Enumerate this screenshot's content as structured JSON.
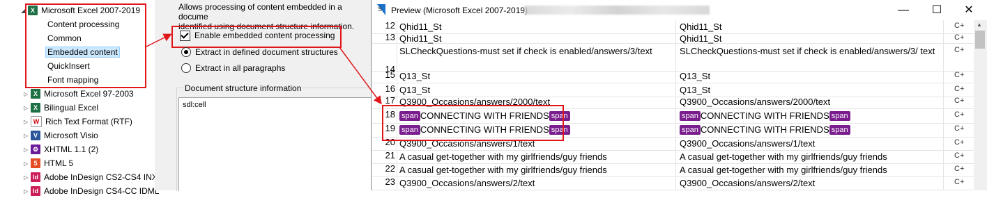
{
  "tree": {
    "items": [
      {
        "label": "Microsoft Excel 2007-2019",
        "icon": "excel-icon",
        "expander": "◢"
      },
      {
        "label": "Content processing"
      },
      {
        "label": "Common"
      },
      {
        "label": "Embedded content"
      },
      {
        "label": "QuickInsert"
      },
      {
        "label": "Font mapping"
      },
      {
        "label": "Microsoft Excel 97-2003",
        "icon": "excel-icon",
        "expander": "▷"
      },
      {
        "label": "Bilingual Excel",
        "icon": "excel-icon",
        "expander": "▷"
      },
      {
        "label": "Rich Text Format (RTF)",
        "icon": "rtf-icon",
        "expander": "▷"
      },
      {
        "label": "Microsoft Visio",
        "icon": "visio-icon",
        "expander": "▷"
      },
      {
        "label": "XHTML 1.1 (2)",
        "icon": "xhtml-icon",
        "expander": "▷"
      },
      {
        "label": "HTML 5",
        "icon": "html5-icon",
        "expander": "▷"
      },
      {
        "label": "Adobe InDesign CS2-CS4 INX",
        "icon": "indesign-icon",
        "expander": "▷"
      },
      {
        "label": "Adobe InDesign CS4-CC IDML",
        "icon": "indesign-icon",
        "expander": "▷"
      }
    ]
  },
  "settings": {
    "description": "Allows processing of content embedded in a docume... identified using document structure information.",
    "description_line1": "Allows processing of content embedded in a docume",
    "description_line2": "identified using document structure information.",
    "enable_label": "Enable embedded content processing",
    "radio1_label": "Extract in defined document structures",
    "radio2_label": "Extract in all paragraphs",
    "group_title": "Document structure information",
    "structure_value": "sdl:cell"
  },
  "preview": {
    "title": "Preview (Microsoft Excel 2007-2019)",
    "minimize": "—",
    "maximize": "☐",
    "close": "✕",
    "tag_label": "span",
    "rows": [
      {
        "n": "12",
        "src": "Qhid11_St",
        "tgt": "Qhid11_St",
        "st": "C+"
      },
      {
        "n": "13",
        "src": "Qhid11_St",
        "tgt": "Qhid11_St",
        "st": "C+"
      },
      {
        "n": "14",
        "src": "SLCheckQuestions-must set if check is enabled/answers/3/text",
        "tgt": "SLCheckQuestions-must set if check is enabled/answers/3/ text",
        "st": "C+"
      },
      {
        "n": "15",
        "src": "Q13_St",
        "tgt": "Q13_St",
        "st": "C+"
      },
      {
        "n": "16",
        "src": "Q13_St",
        "tgt": "Q13_St",
        "st": "C+"
      },
      {
        "n": "17",
        "src": "Q3900_Occasions/answers/2000/text",
        "tgt": "Q3900_Occasions/answers/2000/text",
        "st": "C+"
      },
      {
        "n": "18",
        "src": "CONNECTING WITH FRIENDS",
        "tgt": "CONNECTING WITH FRIENDS",
        "st": "C+"
      },
      {
        "n": "19",
        "src": "CONNECTING WITH FRIENDS",
        "tgt": "CONNECTING WITH FRIENDS",
        "st": "C+"
      },
      {
        "n": "20",
        "src": "Q3900_Occasions/answers/1/text",
        "tgt": "Q3900_Occasions/answers/1/text",
        "st": "C+"
      },
      {
        "n": "21",
        "src": "A casual get-together with my girlfriends/guy friends",
        "tgt": "A casual get-together with my girlfriends/guy friends",
        "st": "C+"
      },
      {
        "n": "22",
        "src": "A casual get-together with my girlfriends/guy friends",
        "tgt": "A casual get-together with my girlfriends/guy friends",
        "st": "C+"
      },
      {
        "n": "23",
        "src": "Q3900_Occasions/answers/2/text",
        "tgt": "Q3900_Occasions/answers/2/text",
        "st": "C+"
      }
    ]
  },
  "colors": {
    "highlight_red": "#e0161b",
    "tag_purple": "#7a1e8e",
    "selection": "#cce8ff",
    "excel_green": "#1e7145"
  }
}
